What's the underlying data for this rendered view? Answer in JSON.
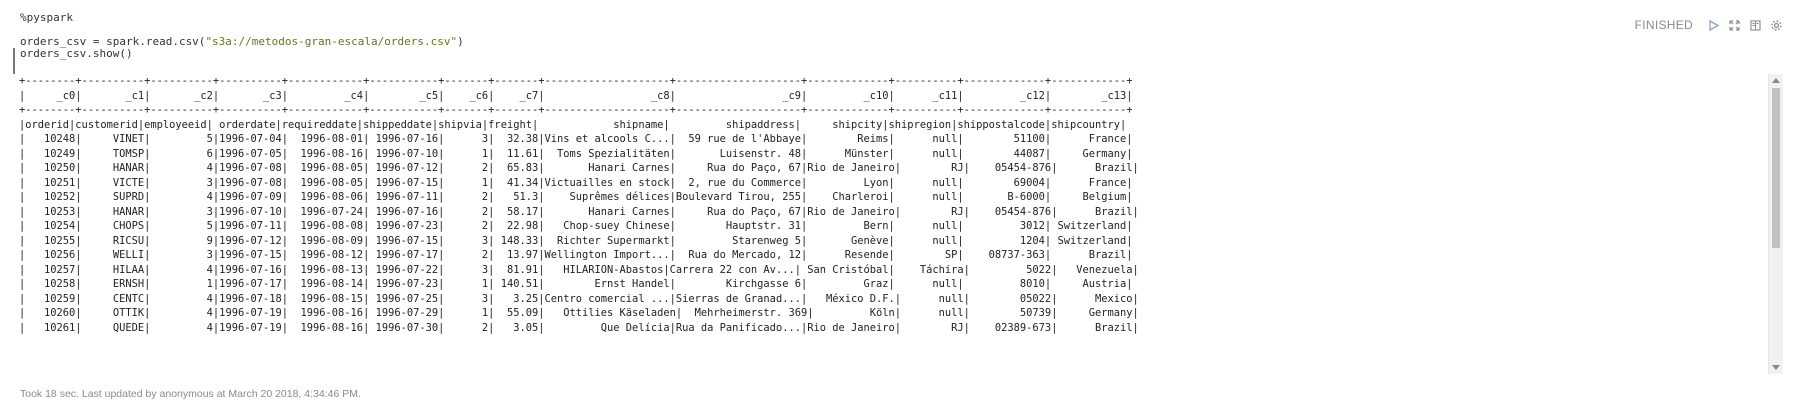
{
  "editor": {
    "lines": [
      "%pyspark",
      "orders_csv = spark.read.csv(",
      "\"s3a://metodos-gran-escala/orders.csv\"",
      ")",
      "orders_csv.show()"
    ]
  },
  "status": {
    "text": "FINISHED"
  },
  "controls": {
    "run_icon": "play-icon",
    "expand_icon": "expand-icon",
    "book_icon": "book-icon",
    "settings_icon": "gear-icon"
  },
  "output": {
    "text": "+--------+----------+----------+----------+------------+-----------+-------+-------+--------------------+--------------------+-------------+----------+-------------+------------+\n|     _c0|       _c1|       _c2|       _c3|         _c4|        _c5|    _c6|    _c7|                 _c8|                 _c9|         _c10|      _c11|         _c12|        _c13|\n+--------+----------+----------+----------+------------+-----------+-------+-------+--------------------+--------------------+-------------+----------+-------------+------------+\n|orderid|customerid|employeeid| orderdate|requireddate|shippeddate|shipvia|freight|            shipname|         shipaddress|     shipcity|shipregion|shippostalcode|shipcountry|\n|   10248|     VINET|         5|1996-07-04|  1996-08-01| 1996-07-16|      3|  32.38|Vins et alcools C...|  59 rue de l'Abbaye|        Reims|      null|        51100|      France|\n|   10249|     TOMSP|         6|1996-07-05|  1996-08-16| 1996-07-10|      1|  11.61|  Toms Spezialitäten|       Luisenstr. 48|      Münster|      null|        44087|     Germany|\n|   10250|     HANAR|         4|1996-07-08|  1996-08-05| 1996-07-12|      2|  65.83|       Hanari Carnes|     Rua do Paço, 67|Rio de Janeiro|        RJ|    05454-876|      Brazil|\n|   10251|     VICTE|         3|1996-07-08|  1996-08-05| 1996-07-15|      1|  41.34|Victuailles en stock|  2, rue du Commerce|         Lyon|      null|        69004|      France|\n|   10252|     SUPRD|         4|1996-07-09|  1996-08-06| 1996-07-11|      2|   51.3|    Suprêmes délices|Boulevard Tirou, 255|    Charleroi|      null|       B-6000|     Belgium|\n|   10253|     HANAR|         3|1996-07-10|  1996-07-24| 1996-07-16|      2|  58.17|       Hanari Carnes|     Rua do Paço, 67|Rio de Janeiro|        RJ|    05454-876|      Brazil|\n|   10254|     CHOPS|         5|1996-07-11|  1996-08-08| 1996-07-23|      2|  22.98|   Chop-suey Chinese|        Hauptstr. 31|         Bern|      null|         3012| Switzerland|\n|   10255|     RICSU|         9|1996-07-12|  1996-08-09| 1996-07-15|      3| 148.33|  Richter Supermarkt|         Starenweg 5|       Genève|      null|         1204| Switzerland|\n|   10256|     WELLI|         3|1996-07-15|  1996-08-12| 1996-07-17|      2|  13.97|Wellington Import...|  Rua do Mercado, 12|      Resende|        SP|    08737-363|      Brazil|\n|   10257|     HILAA|         4|1996-07-16|  1996-08-13| 1996-07-22|      3|  81.91|   HILARION-Abastos|Carrera 22 con Av...| San Cristóbal|    Táchira|         5022|   Venezuela|\n|   10258|     ERNSH|         1|1996-07-17|  1996-08-14| 1996-07-23|      1| 140.51|        Ernst Handel|        Kirchgasse 6|         Graz|      null|         8010|     Austria|\n|   10259|     CENTC|         4|1996-07-18|  1996-08-15| 1996-07-25|      3|   3.25|Centro comercial ...|Sierras de Granad...|   México D.F.|      null|        05022|      Mexico|\n|   10260|     OTTIK|         4|1996-07-19|  1996-08-16| 1996-07-29|      1|  55.09|   Ottilies Käseladen|  Mehrheimerstr. 369|         Köln|      null|        50739|     Germany|\n|   10261|     QUEDE|         4|1996-07-19|  1996-08-16| 1996-07-30|      2|   3.05|         Que Delícia|Rua da Panificado...|Rio de Janeiro|        RJ|    02389-673|      Brazil|"
  },
  "footer": {
    "text": "Took 18 sec. Last updated by anonymous at March 20 2018, 4:34:46 PM."
  }
}
